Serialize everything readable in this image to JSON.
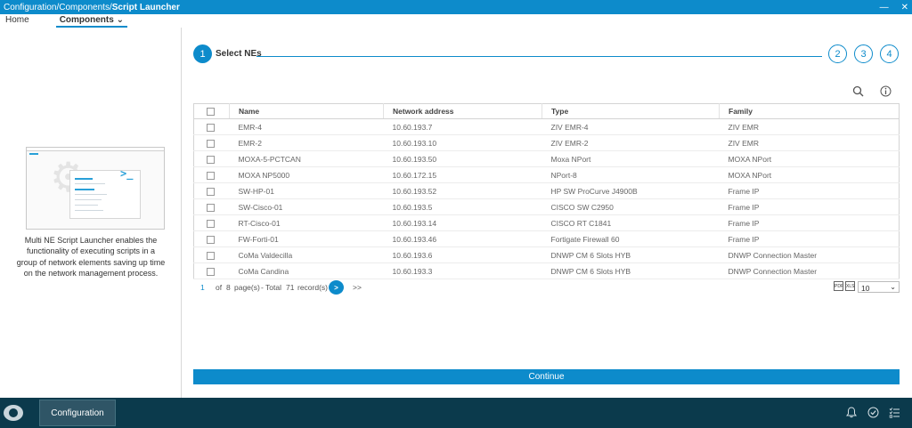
{
  "titlebar": {
    "path": "Configuration/Components/",
    "current": "Script Launcher",
    "minimize_icon": "minimize-icon",
    "close_icon": "close-icon"
  },
  "menu": {
    "home": "Home",
    "components": "Components ⌄"
  },
  "left_panel": {
    "description": "Multi NE Script Launcher enables the functionality of executing scripts in a group of network elements saving up time on the network management process.",
    "prompt_glyph": ">_"
  },
  "wizard": {
    "steps": [
      {
        "number": "1",
        "label": "Select NEs"
      },
      {
        "number": "2"
      },
      {
        "number": "3"
      },
      {
        "number": "4"
      }
    ]
  },
  "toolbar": {
    "search_icon": "search-icon",
    "info_icon": "info-icon"
  },
  "table": {
    "columns": [
      "Name",
      "Network address",
      "Type",
      "Family"
    ],
    "rows": [
      [
        "EMR-4",
        "10.60.193.7",
        "ZIV EMR-4",
        "ZIV EMR"
      ],
      [
        "EMR-2",
        "10.60.193.10",
        "ZIV EMR-2",
        "ZIV EMR"
      ],
      [
        "MOXA-5-PCTCAN",
        "10.60.193.50",
        "Moxa NPort",
        "MOXA NPort"
      ],
      [
        "MOXA NP5000",
        "10.60.172.15",
        "NPort-8",
        "MOXA NPort"
      ],
      [
        "SW-HP-01",
        "10.60.193.52",
        "HP SW ProCurve J4900B",
        "Frame IP"
      ],
      [
        "SW-Cisco-01",
        "10.60.193.5",
        "CISCO SW C2950",
        "Frame IP"
      ],
      [
        "RT-Cisco-01",
        "10.60.193.14",
        "CISCO RT C1841",
        "Frame IP"
      ],
      [
        "FW-Forti-01",
        "10.60.193.46",
        "Fortigate Firewall 60",
        "Frame IP"
      ],
      [
        "CoMa Valdecilla",
        "10.60.193.6",
        "DNWP CM 6 Slots HYB",
        "DNWP Connection Master"
      ],
      [
        "CoMa Candina",
        "10.60.193.3",
        "DNWP CM 6 Slots HYB",
        "DNWP Connection Master"
      ]
    ]
  },
  "pager": {
    "current_page": "1",
    "of_label": "of",
    "total_pages": "8",
    "pages_label": "page(s)",
    "total_label": "- Total",
    "total_records": "71",
    "records_label": "record(s)",
    "next": ">",
    "last": ">>",
    "export_pdf": "PDF",
    "export_xls": "XLS",
    "page_size": "10"
  },
  "continue_label": "Continue",
  "taskbar": {
    "configuration": "Configuration",
    "bell_icon": "bell-icon",
    "check_icon": "check-circle-icon",
    "tasks_icon": "task-list-icon"
  },
  "colors": {
    "accent": "#0d8bcb",
    "taskbar": "#0b3a4c"
  }
}
